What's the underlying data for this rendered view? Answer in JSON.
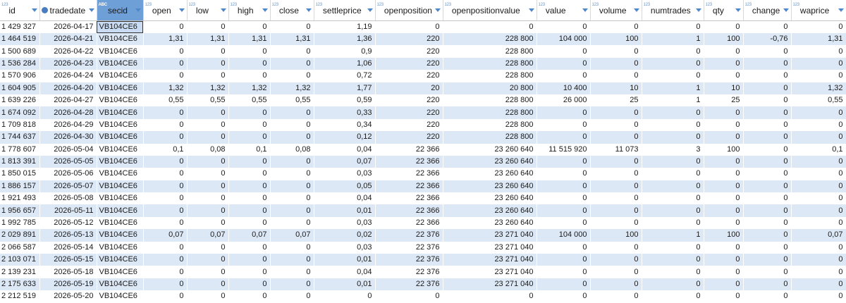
{
  "columns": [
    {
      "label": "id",
      "type": "123"
    },
    {
      "label": "tradedate",
      "type": "date"
    },
    {
      "label": "secid",
      "type": "abc"
    },
    {
      "label": "open",
      "type": "123"
    },
    {
      "label": "low",
      "type": "123"
    },
    {
      "label": "high",
      "type": "123"
    },
    {
      "label": "close",
      "type": "123"
    },
    {
      "label": "settleprice",
      "type": "123"
    },
    {
      "label": "openposition",
      "type": "123"
    },
    {
      "label": "openpositionvalue",
      "type": "123"
    },
    {
      "label": "value",
      "type": "123"
    },
    {
      "label": "volume",
      "type": "123"
    },
    {
      "label": "numtrades",
      "type": "123"
    },
    {
      "label": "qty",
      "type": "123"
    },
    {
      "label": "change",
      "type": "123"
    },
    {
      "label": "waprice",
      "type": "123"
    }
  ],
  "type_icons": {
    "num": "123",
    "abc": "ABC",
    "date": "calendar-icon"
  },
  "selected_column": "secid",
  "rows": [
    [
      "1 429 327",
      "2026-04-17",
      "VB104CE6",
      "0",
      "0",
      "0",
      "0",
      "1,19",
      "0",
      "0",
      "0",
      "0",
      "0",
      "0",
      "0",
      "0"
    ],
    [
      "1 464 519",
      "2026-04-21",
      "VB104CE6",
      "1,31",
      "1,31",
      "1,31",
      "1,31",
      "1,36",
      "220",
      "228 800",
      "104 000",
      "100",
      "1",
      "100",
      "-0,76",
      "1,31"
    ],
    [
      "1 500 689",
      "2026-04-22",
      "VB104CE6",
      "0",
      "0",
      "0",
      "0",
      "0,9",
      "220",
      "228 800",
      "0",
      "0",
      "0",
      "0",
      "0",
      "0"
    ],
    [
      "1 536 284",
      "2026-04-23",
      "VB104CE6",
      "0",
      "0",
      "0",
      "0",
      "1,06",
      "220",
      "228 800",
      "0",
      "0",
      "0",
      "0",
      "0",
      "0"
    ],
    [
      "1 570 906",
      "2026-04-24",
      "VB104CE6",
      "0",
      "0",
      "0",
      "0",
      "0,72",
      "220",
      "228 800",
      "0",
      "0",
      "0",
      "0",
      "0",
      "0"
    ],
    [
      "1 604 905",
      "2026-04-20",
      "VB104CE6",
      "1,32",
      "1,32",
      "1,32",
      "1,32",
      "1,77",
      "20",
      "20 800",
      "10 400",
      "10",
      "1",
      "10",
      "0",
      "1,32"
    ],
    [
      "1 639 226",
      "2026-04-27",
      "VB104CE6",
      "0,55",
      "0,55",
      "0,55",
      "0,55",
      "0,59",
      "220",
      "228 800",
      "26 000",
      "25",
      "1",
      "25",
      "0",
      "0,55"
    ],
    [
      "1 674 092",
      "2026-04-28",
      "VB104CE6",
      "0",
      "0",
      "0",
      "0",
      "0,33",
      "220",
      "228 800",
      "0",
      "0",
      "0",
      "0",
      "0",
      "0"
    ],
    [
      "1 709 818",
      "2026-04-29",
      "VB104CE6",
      "0",
      "0",
      "0",
      "0",
      "0,34",
      "220",
      "228 800",
      "0",
      "0",
      "0",
      "0",
      "0",
      "0"
    ],
    [
      "1 744 637",
      "2026-04-30",
      "VB104CE6",
      "0",
      "0",
      "0",
      "0",
      "0,12",
      "220",
      "228 800",
      "0",
      "0",
      "0",
      "0",
      "0",
      "0"
    ],
    [
      "1 778 607",
      "2026-05-04",
      "VB104CE6",
      "0,1",
      "0,08",
      "0,1",
      "0,08",
      "0,04",
      "22 366",
      "23 260 640",
      "11 515 920",
      "11 073",
      "3",
      "100",
      "0",
      "0,1"
    ],
    [
      "1 813 391",
      "2026-05-05",
      "VB104CE6",
      "0",
      "0",
      "0",
      "0",
      "0,07",
      "22 366",
      "23 260 640",
      "0",
      "0",
      "0",
      "0",
      "0",
      "0"
    ],
    [
      "1 850 015",
      "2026-05-06",
      "VB104CE6",
      "0",
      "0",
      "0",
      "0",
      "0,03",
      "22 366",
      "23 260 640",
      "0",
      "0",
      "0",
      "0",
      "0",
      "0"
    ],
    [
      "1 886 157",
      "2026-05-07",
      "VB104CE6",
      "0",
      "0",
      "0",
      "0",
      "0,05",
      "22 366",
      "23 260 640",
      "0",
      "0",
      "0",
      "0",
      "0",
      "0"
    ],
    [
      "1 921 493",
      "2026-05-08",
      "VB104CE6",
      "0",
      "0",
      "0",
      "0",
      "0,04",
      "22 366",
      "23 260 640",
      "0",
      "0",
      "0",
      "0",
      "0",
      "0"
    ],
    [
      "1 956 657",
      "2026-05-11",
      "VB104CE6",
      "0",
      "0",
      "0",
      "0",
      "0,01",
      "22 366",
      "23 260 640",
      "0",
      "0",
      "0",
      "0",
      "0",
      "0"
    ],
    [
      "1 992 785",
      "2026-05-12",
      "VB104CE6",
      "0",
      "0",
      "0",
      "0",
      "0,03",
      "22 366",
      "23 260 640",
      "0",
      "0",
      "0",
      "0",
      "0",
      "0"
    ],
    [
      "2 029 891",
      "2026-05-13",
      "VB104CE6",
      "0,07",
      "0,07",
      "0,07",
      "0,07",
      "0,02",
      "22 376",
      "23 271 040",
      "104 000",
      "100",
      "1",
      "100",
      "0",
      "0,07"
    ],
    [
      "2 066 587",
      "2026-05-14",
      "VB104CE6",
      "0",
      "0",
      "0",
      "0",
      "0,03",
      "22 376",
      "23 271 040",
      "0",
      "0",
      "0",
      "0",
      "0",
      "0"
    ],
    [
      "2 103 071",
      "2026-05-15",
      "VB104CE6",
      "0",
      "0",
      "0",
      "0",
      "0,01",
      "22 376",
      "23 271 040",
      "0",
      "0",
      "0",
      "0",
      "0",
      "0"
    ],
    [
      "2 139 231",
      "2026-05-18",
      "VB104CE6",
      "0",
      "0",
      "0",
      "0",
      "0,04",
      "22 376",
      "23 271 040",
      "0",
      "0",
      "0",
      "0",
      "0",
      "0"
    ],
    [
      "2 175 633",
      "2026-05-19",
      "VB104CE6",
      "0",
      "0",
      "0",
      "0",
      "0,01",
      "22 376",
      "23 271 040",
      "0",
      "0",
      "0",
      "0",
      "0",
      "0"
    ],
    [
      "2 212 519",
      "2026-05-20",
      "VB104CE6",
      "0",
      "0",
      "0",
      "0",
      "0",
      "0",
      "0",
      "0",
      "0",
      "0",
      "0",
      "0",
      "0"
    ]
  ]
}
